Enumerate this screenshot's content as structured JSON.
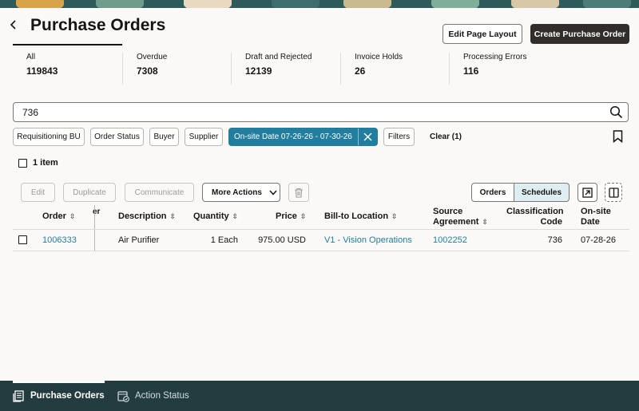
{
  "header": {
    "title": "Purchase Orders",
    "edit_layout_label": "Edit Page Layout",
    "create_label": "Create Purchase Order"
  },
  "counts": [
    {
      "label": "All",
      "value": "119843"
    },
    {
      "label": "Overdue",
      "value": "7308"
    },
    {
      "label": "Draft and Rejected",
      "value": "12139"
    },
    {
      "label": "Invoice Holds",
      "value": "26"
    },
    {
      "label": "Processing Errors",
      "value": "116"
    }
  ],
  "search": {
    "value": "736"
  },
  "filters": {
    "chips": [
      "Requisitioning BU",
      "Order Status",
      "Buyer",
      "Supplier"
    ],
    "active_chip": "On-site Date 07-26-26 - 07-30-26",
    "filters_label": "Filters",
    "clear_label": "Clear (1)"
  },
  "results": {
    "count_label": "1 item"
  },
  "toolbar": {
    "edit": "Edit",
    "duplicate": "Duplicate",
    "communicate": "Communicate",
    "more_actions": "More Actions",
    "view_orders": "Orders",
    "view_schedules": "Schedules"
  },
  "table": {
    "columns": {
      "order": "Order",
      "supplier_partial": "er",
      "description": "Description",
      "quantity": "Quantity",
      "price": "Price",
      "bill_to": "Bill-to Location",
      "source_agreement_1": "Source",
      "source_agreement_2": "Agreement",
      "classification_1": "Classification",
      "classification_2": "Code",
      "onsite_1": "On-site",
      "onsite_2": "Date"
    },
    "rows": [
      {
        "order": "1006333",
        "description": "Air Purifier",
        "quantity": "1 Each",
        "price": "975.00 USD",
        "bill_to": "V1 - Vision Operations",
        "source_agreement": "1002252",
        "classification_code": "736",
        "onsite_date": "07-28-26"
      }
    ]
  },
  "footer": {
    "tabs": [
      "Purchase Orders",
      "Action Status"
    ]
  },
  "colors": {
    "accent": "#227e9e",
    "dark_button": "#312d2a",
    "footer_bg": "#233c40",
    "selected_segment": "#dfeef3"
  }
}
